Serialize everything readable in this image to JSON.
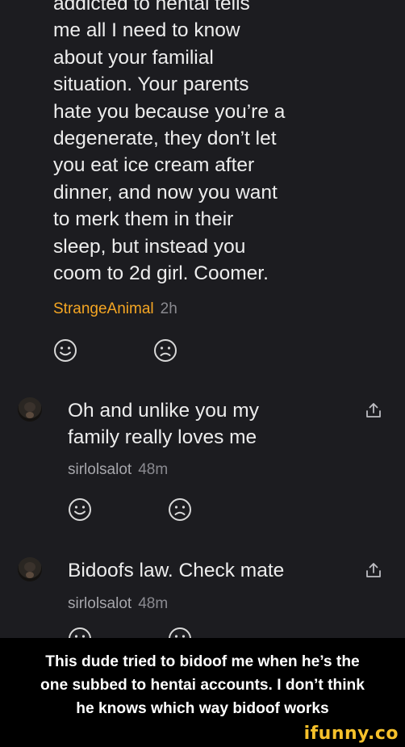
{
  "comment1": {
    "lines": [
      "addicted to hentai tells",
      "me all I need to know",
      "about your familial",
      "situation. Your parents",
      "hate you because you’re a",
      "degenerate, they don’t let",
      "you eat ice cream after",
      "dinner, and now you want",
      "to merk them in their",
      "sleep, but instead you",
      "coom to 2d girl. Coomer."
    ],
    "username": "StrangeAnimal",
    "time": "2h"
  },
  "reply1": {
    "lines": [
      "Oh and unlike you my",
      "family really loves me"
    ],
    "username": "sirlolsalot",
    "time": "48m"
  },
  "reply2": {
    "lines": [
      "Bidoofs law. Check mate"
    ],
    "username": "sirlolsalot",
    "time": "48m"
  },
  "caption": {
    "lines": [
      "This dude tried to bidoof me when he’s the",
      "one subbed to hentai accounts. I don’t think",
      "he knows which way bidoof works"
    ]
  },
  "watermark": "ifunny.co",
  "colors": {
    "background": "#1c1c20",
    "username_op": "#f5a623",
    "username": "#a6a6ab",
    "watermark": "#f6c12b"
  },
  "icons": [
    "smile-icon",
    "frown-icon",
    "share-icon",
    "avatar"
  ]
}
